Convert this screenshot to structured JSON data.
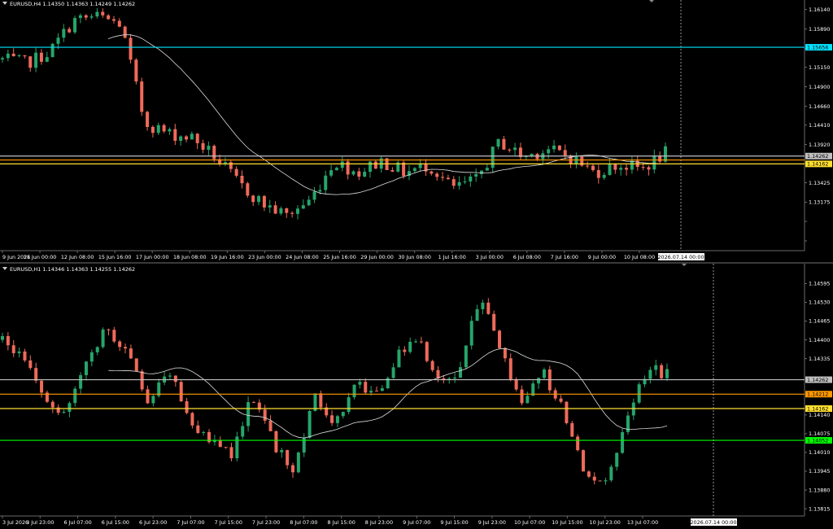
{
  "panes": [
    {
      "id": "h4",
      "title": "EURUSD,H4  1.14350 1.14363 1.14249 1.14262",
      "price_ticks": [
        "1.16140",
        "1.15890",
        "1.15656",
        "1.15400",
        "1.15150",
        "1.14900",
        "1.14660",
        "1.14410",
        "1.14262",
        "1.14162",
        "1.13920",
        "1.13670",
        "1.13425",
        "1.13175"
      ],
      "price_tick_values": [
        1.1614,
        1.1589,
        1.1564,
        1.154,
        1.1515,
        1.149,
        1.1466,
        1.1441,
        1.1417,
        1.1392,
        1.1367,
        1.13425,
        1.13175
      ],
      "time_ticks": [
        "9 Jun 2026",
        "11 Jun 00:00",
        "12 Jun 08:00",
        "15 Jun 16:00",
        "17 Jun 00:00",
        "18 Jun 08:00",
        "19 Jun 16:00",
        "23 Jun 00:00",
        "24 Jun 08:00",
        "25 Jun 16:00",
        "29 Jun 00:00",
        "30 Jun 08:00",
        "1 Jul 16:00",
        "3 Jul 00:00",
        "6 Jul 08:00",
        "7 Jul 16:00",
        "9 Jul 00:00",
        "10 Jul 08:00"
      ],
      "crosshair_time_label": "2026.07.14 00:00",
      "hlines": [
        {
          "price": 1.15656,
          "color": "#00e5ff",
          "label": "1.15656"
        },
        {
          "price": 1.14262,
          "color": "#c0c0c0",
          "label": "1.14262"
        },
        {
          "price": 1.14212,
          "color": "#ff9900",
          "label": ""
        },
        {
          "price": 1.14162,
          "color": "#ffe030",
          "label": "1.14162"
        }
      ],
      "price_range": [
        1.1305,
        1.1622
      ],
      "ma_period": 20,
      "candles_approx_count": 120
    },
    {
      "id": "h1",
      "title": "EURUSD,H1  1.14346 1.14363 1.14255 1.14262",
      "price_ticks": [
        "1.14595",
        "1.14530",
        "1.14465",
        "1.14400",
        "1.14335",
        "1.14262",
        "1.14212",
        "1.14162",
        "1.14140",
        "1.14075",
        "1.14052",
        "1.14010",
        "1.13945",
        "1.13880",
        "1.13815"
      ],
      "price_tick_values": [
        1.14595,
        1.1453,
        1.14465,
        1.144,
        1.14335,
        1.1414,
        1.14075,
        1.1401,
        1.13945,
        1.1388,
        1.13815
      ],
      "time_ticks": [
        "3 Jul 2026",
        "3 Jul 23:00",
        "6 Jul 07:00",
        "6 Jul 15:00",
        "6 Jul 23:00",
        "7 Jul 07:00",
        "7 Jul 15:00",
        "7 Jul 23:00",
        "8 Jul 07:00",
        "8 Jul 15:00",
        "8 Jul 23:00",
        "9 Jul 07:00",
        "9 Jul 15:00",
        "9 Jul 23:00",
        "10 Jul 07:00",
        "10 Jul 15:00",
        "10 Jul 23:00",
        "13 Jul 07:00"
      ],
      "crosshair_time_label": "2026.07.14 00:00",
      "hlines": [
        {
          "price": 1.14262,
          "color": "#c0c0c0",
          "label": "1.14262"
        },
        {
          "price": 1.14212,
          "color": "#ff9900",
          "label": "1.14212"
        },
        {
          "price": 1.14162,
          "color": "#ffe030",
          "label": "1.14162"
        },
        {
          "price": 1.14052,
          "color": "#00ff00",
          "label": "1.14052"
        }
      ],
      "price_range": [
        1.1379,
        1.1463
      ],
      "ma_period": 20,
      "candles_approx_count": 120
    }
  ],
  "colors": {
    "bull": "#26a56a",
    "bear": "#ef6a5a",
    "ma": "#dddddd",
    "axis_text": "#ffffff",
    "grid_frame": "#6a6a6a"
  }
}
